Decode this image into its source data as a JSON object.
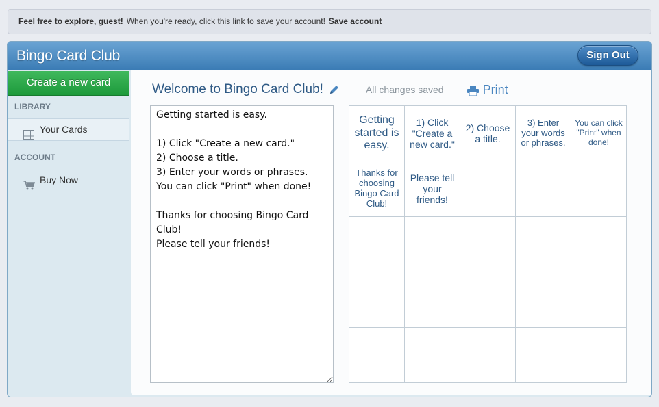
{
  "notice": {
    "greeting": "Feel free to explore, guest!",
    "message": "When you're ready, click this link to save your account!",
    "link": "Save account"
  },
  "app": {
    "title": "Bingo Card Club",
    "sign_out": "Sign Out"
  },
  "sidebar": {
    "create_button": "Create a new card",
    "library_label": "LIBRARY",
    "your_cards": "Your Cards",
    "account_label": "ACCOUNT",
    "buy_now": "Buy Now"
  },
  "editor": {
    "title": "Welcome to Bingo Card Club!",
    "status": "All changes saved",
    "print": "Print",
    "text": "Getting started is easy.\n\n1) Click \"Create a new card.\"\n2) Choose a title.\n3) Enter your words or phrases.\nYou can click \"Print\" when done!\n\nThanks for choosing Bingo Card Club!\nPlease tell your friends!"
  },
  "grid": {
    "cells": [
      [
        "Getting started is easy.",
        "1) Click \"Create a new card.\"",
        "2) Choose a title.",
        "3) Enter your words or phrases.",
        "You can click \"Print\" when done!"
      ],
      [
        "Thanks for choosing Bingo Card Club!",
        "Please tell your friends!",
        "",
        "",
        ""
      ],
      [
        "",
        "",
        "",
        "",
        ""
      ],
      [
        "",
        "",
        "",
        "",
        ""
      ],
      [
        "",
        "",
        "",
        "",
        ""
      ]
    ],
    "font_sizes": [
      [
        16,
        14,
        14,
        13,
        12
      ],
      [
        13,
        14,
        14,
        14,
        14
      ],
      [
        14,
        14,
        14,
        14,
        14
      ],
      [
        14,
        14,
        14,
        14,
        14
      ],
      [
        14,
        14,
        14,
        14,
        14
      ]
    ]
  },
  "colors": {
    "header": "#3b7cb5",
    "create_button": "#1d9a3b",
    "link_text": "#2f5a85",
    "print": "#4a86c0"
  }
}
